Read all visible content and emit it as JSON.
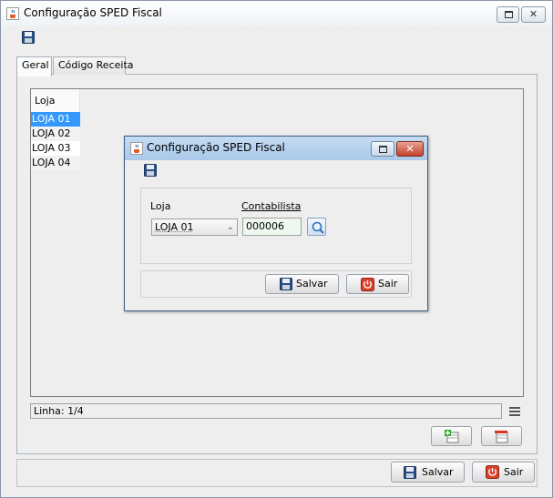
{
  "window": {
    "title": "Configuração SPED Fiscal"
  },
  "tabs": [
    "Geral",
    "Código Receita"
  ],
  "table": {
    "header": "Loja",
    "rows": [
      "LOJA 01",
      "LOJA 02",
      "LOJA 03",
      "LOJA 04"
    ],
    "selected_index": 0
  },
  "status": {
    "text": "Linha: 1/4"
  },
  "bottom_buttons": {
    "save": "Salvar",
    "exit": "Sair"
  },
  "dialog": {
    "title": "Configuração SPED Fiscal",
    "loja_label": "Loja",
    "loja_value": "LOJA 01",
    "contabilista_label": "Contabilista",
    "contabilista_value": "000006",
    "save": "Salvar",
    "exit": "Sair"
  },
  "icons": {
    "app": "java-cup-icon",
    "save": "floppy-disk-icon",
    "add_row": "add-row-icon",
    "delete_row": "delete-row-icon",
    "lookup": "search-icon",
    "exit": "power-icon",
    "menu": "menu-lines-icon"
  },
  "colors": {
    "selection": "#3399ff",
    "exit_red": "#d9412b",
    "dialog_title": "#b9d3ef"
  }
}
